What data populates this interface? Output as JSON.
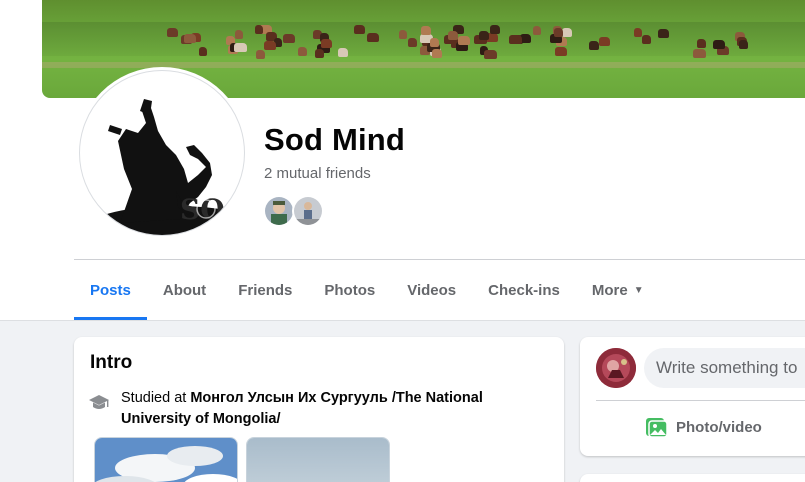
{
  "profile": {
    "name": "Sod Mind",
    "mutual_friends": "2 mutual friends"
  },
  "tabs": [
    {
      "label": "Posts",
      "active": true
    },
    {
      "label": "About"
    },
    {
      "label": "Friends"
    },
    {
      "label": "Photos"
    },
    {
      "label": "Videos"
    },
    {
      "label": "Check-ins"
    },
    {
      "label": "More"
    }
  ],
  "intro": {
    "title": "Intro",
    "education_prefix": "Studied at ",
    "education_school": "Монгол Улсын Их Сургууль /The National University of Mongolia/"
  },
  "composer": {
    "placeholder": "Write something to",
    "photo_video": "Photo/video"
  },
  "icons": {
    "education": "graduation-cap-icon",
    "photo_video": "photo-icon",
    "more_caret": "caret-down-icon"
  },
  "colors": {
    "accent": "#1877f2",
    "photo_icon_green": "#45bd62",
    "secondary_text": "#65676b",
    "background": "#f0f2f5"
  }
}
